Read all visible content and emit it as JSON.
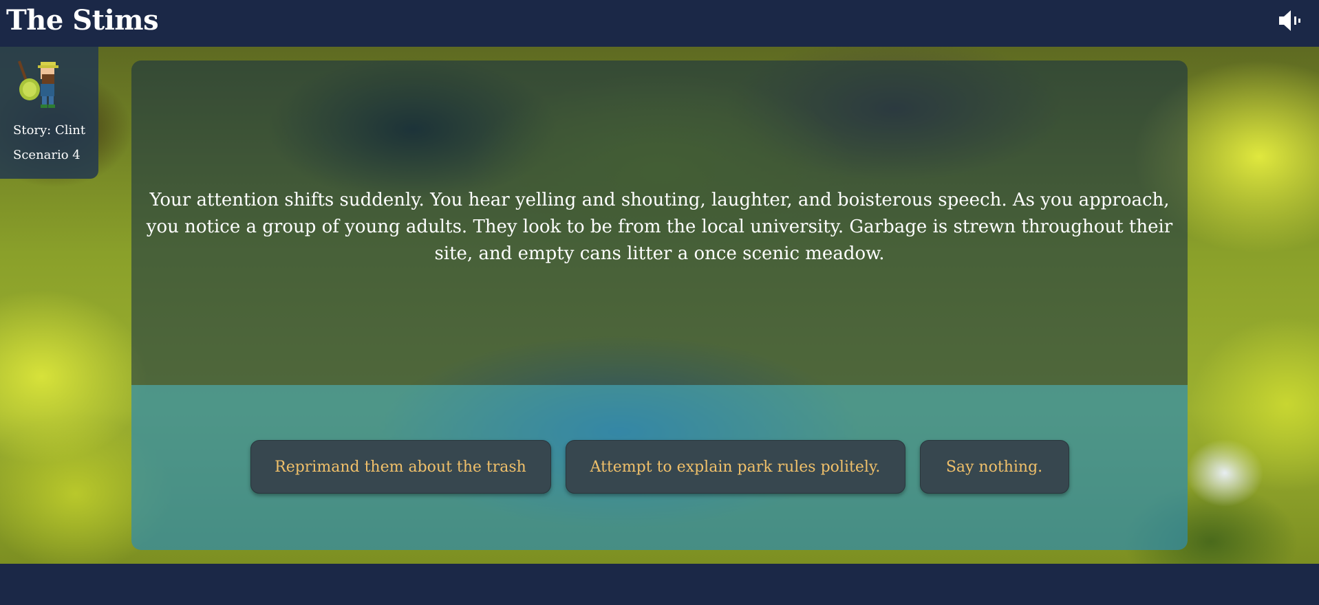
{
  "header": {
    "title": "The Stims",
    "sound_icon": "speaker-volume-icon"
  },
  "character": {
    "avatar_icon": "hiker-character-icon",
    "story": "Story: Clint",
    "scenario": "Scenario 4"
  },
  "narration": {
    "text": "Your attention shifts suddenly. You hear yelling and shouting, laughter, and boisterous speech. As you approach, you notice a group of young adults. They look to be from the local university. Garbage is strewn throughout their site, and empty cans litter a once scenic meadow."
  },
  "choices": [
    {
      "label": "Reprimand them about the trash"
    },
    {
      "label": "Attempt to explain park rules politely."
    },
    {
      "label": "Say nothing."
    }
  ],
  "colors": {
    "header_bg": "#1b2847",
    "choice_text": "#f0c06a",
    "choice_bg": "#37474f"
  }
}
